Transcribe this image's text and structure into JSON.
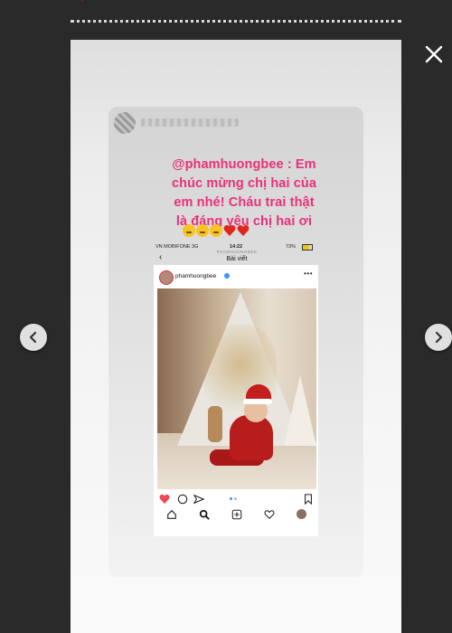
{
  "story": {
    "close_icon": "close-icon",
    "prev_icon": "chevron-left-icon",
    "next_icon": "chevron-right-icon"
  },
  "shared_post": {
    "mention_lines": [
      "@phamhuongbee : Em",
      "chúc mừng chị hai của",
      "em nhé! Cháu trai thật",
      "là đáng yêu chị hai ơi"
    ],
    "emojis": [
      "crying-laughing-emoji",
      "crying-laughing-emoji",
      "crying-laughing-emoji",
      "heart-emoji",
      "heart-emoji"
    ]
  },
  "phone": {
    "carrier": "VN MOBIFONE  3G",
    "time": "14:22",
    "battery": "73%",
    "header_sub": "PHAMHUONGBEE",
    "header_title": "Bài viết",
    "username": "phamhuongbee",
    "colors": {
      "mention": "#e8317b",
      "like": "#ed4956",
      "verified": "#3897f0"
    }
  }
}
